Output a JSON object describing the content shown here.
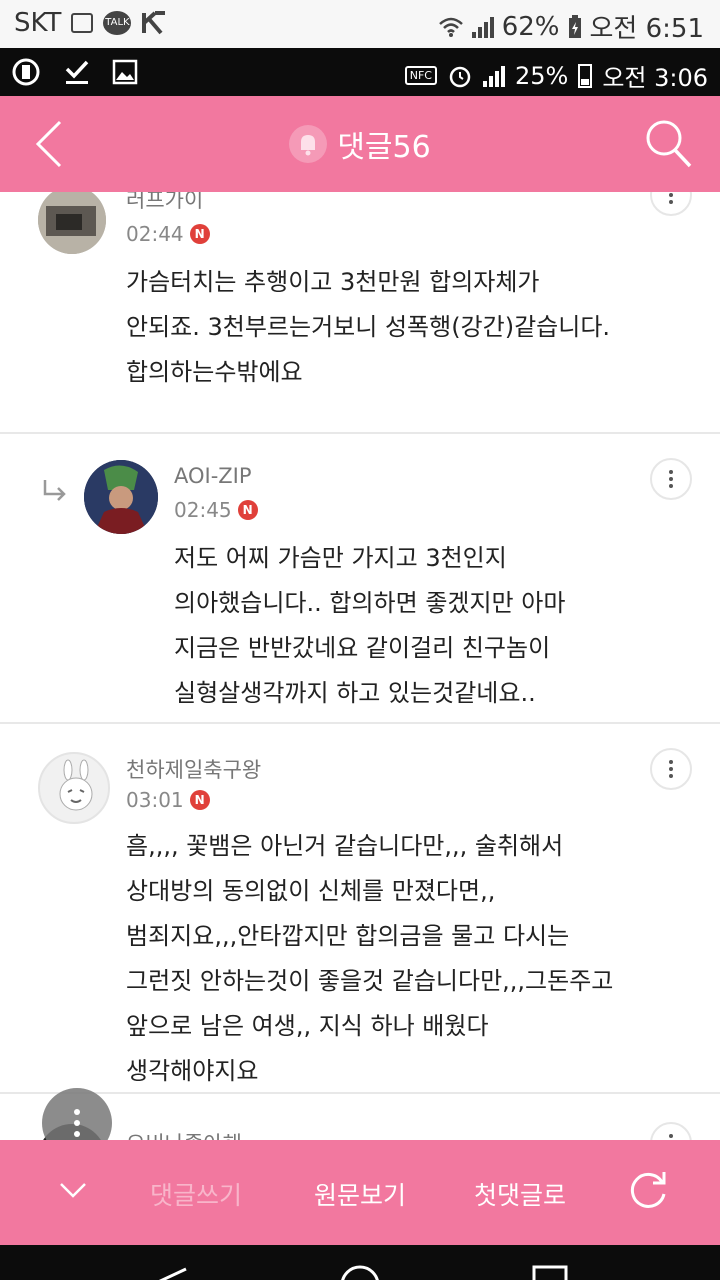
{
  "outer_status": {
    "carrier": "SKT",
    "talk_label": "TALK",
    "battery": "62%",
    "time": "오전 6:51"
  },
  "inner_status": {
    "nfc": "NFC",
    "battery": "25%",
    "time": "오전 3:06"
  },
  "header": {
    "title": "댓글56"
  },
  "comments": [
    {
      "author": "러프가이",
      "time": "02:44",
      "badge": "N",
      "lines": [
        "가슴터치는 추행이고 3천만원 합의자체가",
        "안되죠. 3천부르는거보니 성폭행(강간)같습니다.",
        "합의하는수밖에요"
      ]
    },
    {
      "author": "AOI-ZIP",
      "time": "02:45",
      "badge": "N",
      "lines": [
        "저도 어찌 가슴만 가지고 3천인지",
        "의아했습니다.. 합의하면 좋겠지만 아마",
        "지금은 반반갔네요 같이걸리 친구놈이",
        "실형살생각까지 하고 있는것같네요.."
      ]
    },
    {
      "author": "천하제일축구왕",
      "time": "03:01",
      "badge": "N",
      "lines": [
        "흠,,,, 꽃뱀은 아닌거 같습니다만,,, 술취해서",
        "상대방의 동의없이 신체를 만졌다면,,",
        "범죄지요,,,안타깝지만 합의금을 물고 다시는",
        "그런짓 안하는것이 좋을것 같습니다만,,,그돈주고",
        "앞으로 남은 여생,, 지식 하나 배웠다",
        "생각해야지요"
      ]
    },
    {
      "author": "오비나좋아해"
    }
  ],
  "bottom_bar": {
    "write": "댓글쓰기",
    "original": "원문보기",
    "first": "첫댓글로"
  }
}
